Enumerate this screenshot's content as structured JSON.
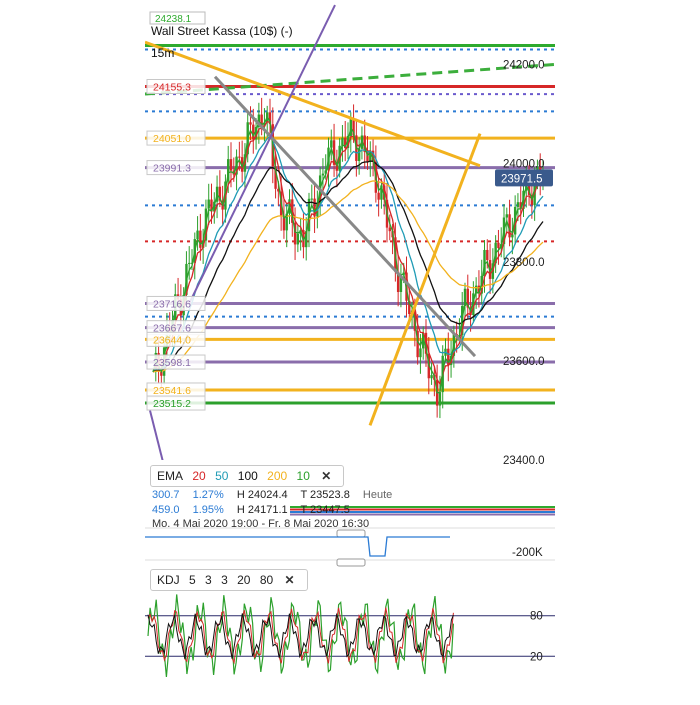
{
  "header": {
    "instrument": "Wall Street Kassa (10$) (-)",
    "timeframe": "15m",
    "top_clip_label": "24238.1"
  },
  "chart_data": {
    "type": "candlestick",
    "main": {
      "y_range": [
        23400,
        24310
      ],
      "y_ticks": [
        "24200.0",
        "24000.0",
        "23800.0",
        "23600.0",
        "23400.0"
      ],
      "y_tick_values": [
        24200,
        24000,
        23800,
        23600,
        23400
      ],
      "last_price": "23971.5",
      "last_price_value": 23971.5,
      "level_labels": [
        {
          "text": "24155.3",
          "value": 24155.3,
          "color": "#d62728"
        },
        {
          "text": "24051.0",
          "value": 24051.0,
          "color": "#f2b21e"
        },
        {
          "text": "23991.3",
          "value": 23991.3,
          "color": "#8a6dab"
        },
        {
          "text": "23716.6",
          "value": 23716.6,
          "color": "#8a6dab"
        },
        {
          "text": "23667.6",
          "value": 23667.6,
          "color": "#8a6dab"
        },
        {
          "text": "23644.0",
          "value": 23644.0,
          "color": "#f2b21e"
        },
        {
          "text": "23598.1",
          "value": 23598.1,
          "color": "#8a6dab"
        },
        {
          "text": "23541.6",
          "value": 23541.6,
          "color": "#f2b21e"
        },
        {
          "text": "23515.2",
          "value": 23515.2,
          "color": "#2ca02c"
        }
      ],
      "levels": [
        {
          "value": 24238.1,
          "color": "#2eaa2e",
          "style": "solid"
        },
        {
          "value": 24230,
          "color": "#2b7bd4",
          "style": "dotted"
        },
        {
          "value": 24155.3,
          "color": "#d62728",
          "style": "solid"
        },
        {
          "value": 24140,
          "color": "#6a5acd",
          "style": "dotted"
        },
        {
          "value": 24105,
          "color": "#2b7bd4",
          "style": "dotted"
        },
        {
          "value": 24051.0,
          "color": "#f2b21e",
          "style": "solid"
        },
        {
          "value": 23991.3,
          "color": "#8a6dab",
          "style": "solid"
        },
        {
          "value": 23915,
          "color": "#2b7bd4",
          "style": "dotted"
        },
        {
          "value": 23842,
          "color": "#d62728",
          "style": "dotted"
        },
        {
          "value": 23716.6,
          "color": "#8a6dab",
          "style": "solid"
        },
        {
          "value": 23690,
          "color": "#2b7bd4",
          "style": "dotted"
        },
        {
          "value": 23667.6,
          "color": "#8a6dab",
          "style": "solid"
        },
        {
          "value": 23644.0,
          "color": "#f2b21e",
          "style": "solid"
        },
        {
          "value": 23598.1,
          "color": "#8a6dab",
          "style": "solid"
        },
        {
          "value": 23541.6,
          "color": "#f2b21e",
          "style": "solid"
        },
        {
          "value": 23515.2,
          "color": "#2ca02c",
          "style": "solid"
        }
      ],
      "emas": [
        {
          "name": "20",
          "color": "#d62728"
        },
        {
          "name": "50",
          "color": "#1f9bb5"
        },
        {
          "name": "100",
          "color": "#111111"
        },
        {
          "name": "200",
          "color": "#f2b21e"
        },
        {
          "name": "10",
          "color": "#2ca02c"
        }
      ]
    },
    "ema_legend": {
      "label": "EMA",
      "periods": [
        "20",
        "50",
        "100",
        "200",
        "10"
      ],
      "colors": [
        "#d62728",
        "#1f9bb5",
        "#111111",
        "#f2b21e",
        "#2ca02c"
      ]
    },
    "volume": {
      "tick_label": "-200K"
    },
    "kdj": {
      "label": "KDJ",
      "params": [
        "5",
        "3",
        "3",
        "20",
        "80"
      ],
      "levels": [
        "80",
        "20"
      ],
      "level_values": [
        80,
        20
      ],
      "y_range": [
        -15,
        115
      ]
    }
  },
  "stats": {
    "row1": {
      "value": "300.7",
      "pct": "1.27%",
      "high": "H 24024.4",
      "low": "T 23523.8",
      "period": "Heute"
    },
    "row2": {
      "value": "459.0",
      "pct": "1.95%",
      "high": "H 24171.1",
      "low": "T 23447.5"
    },
    "range": "Mo. 4 Mai 2020 19:00 - Fr. 8 Mai 2020 16:30"
  },
  "colors": {
    "up": "#2ca02c",
    "down": "#d62728",
    "last_price_bg": "#3a5a8c",
    "grey_trend": "#888888",
    "purple_trend": "#7a5db0",
    "orange_trend": "#f2b21e",
    "green_dash": "#3cae3c"
  }
}
